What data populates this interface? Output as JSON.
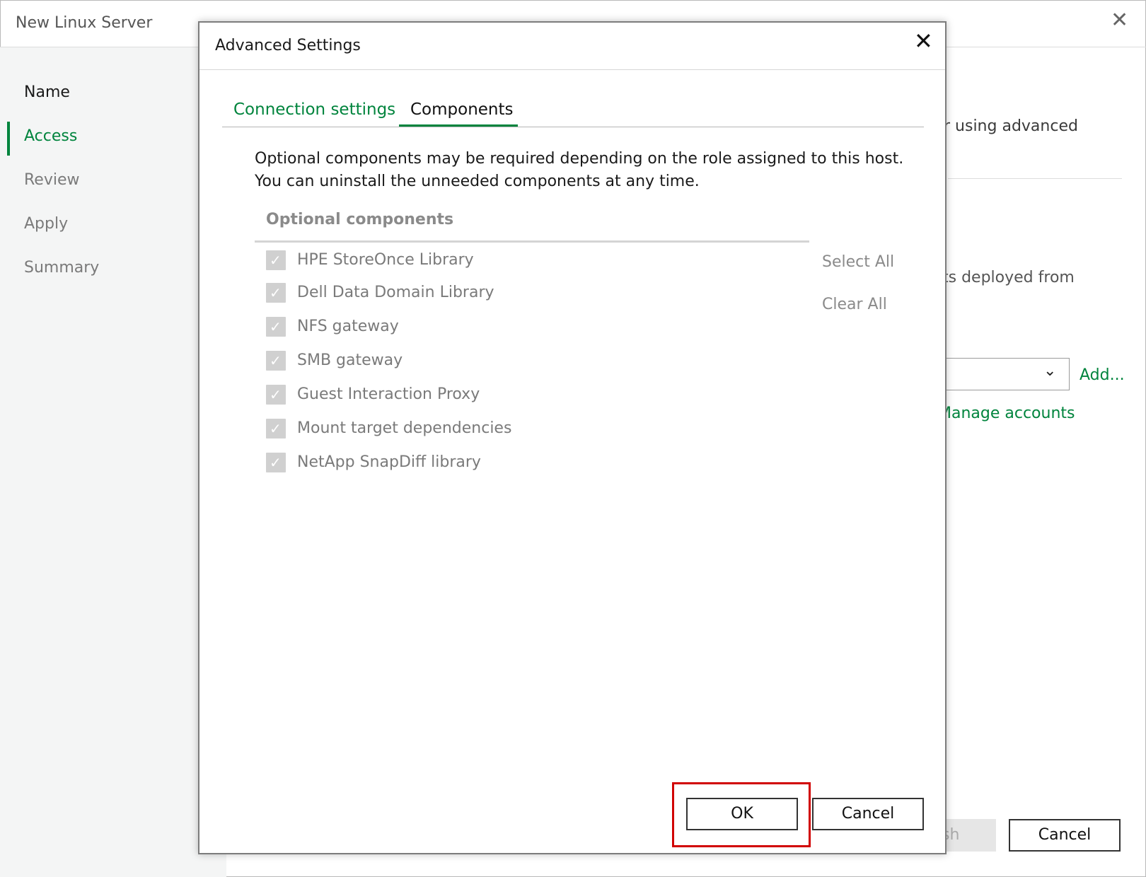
{
  "wizard": {
    "title": "New Linux Server",
    "close_icon": "close-icon",
    "steps": [
      {
        "label": "Name",
        "state": "done"
      },
      {
        "label": "Access",
        "state": "active"
      },
      {
        "label": "Review",
        "state": "pending"
      },
      {
        "label": "Apply",
        "state": "pending"
      },
      {
        "label": "Summary",
        "state": "pending"
      }
    ],
    "bg_text_1": "r using advanced",
    "bg_text_2": "ts deployed from",
    "bg_add_link": "Add...",
    "bg_manage_link": "Manage accounts",
    "bg_finish_label": "sh",
    "bg_cancel_label": "Cancel"
  },
  "dialog": {
    "title": "Advanced Settings",
    "tabs": [
      {
        "label": "Connection settings",
        "active": false
      },
      {
        "label": "Components",
        "active": true
      }
    ],
    "description_line1": "Optional components may be required depending on the role assigned to this host.",
    "description_line2": "You can uninstall the unneeded components at any time.",
    "components_header": "Optional components",
    "components": [
      {
        "label": "HPE StoreOnce Library",
        "checked": true
      },
      {
        "label": "Dell Data Domain Library",
        "checked": true
      },
      {
        "label": "NFS gateway",
        "checked": true
      },
      {
        "label": "SMB gateway",
        "checked": true
      },
      {
        "label": "Guest Interaction Proxy",
        "checked": true
      },
      {
        "label": "Mount target dependencies",
        "checked": true
      },
      {
        "label": "NetApp SnapDiff library",
        "checked": true
      }
    ],
    "select_all_label": "Select All",
    "clear_all_label": "Clear All",
    "ok_label": "OK",
    "cancel_label": "Cancel"
  },
  "colors": {
    "accent": "#00843d",
    "highlight": "#d10000",
    "disabled_text": "#7a7a7a"
  }
}
